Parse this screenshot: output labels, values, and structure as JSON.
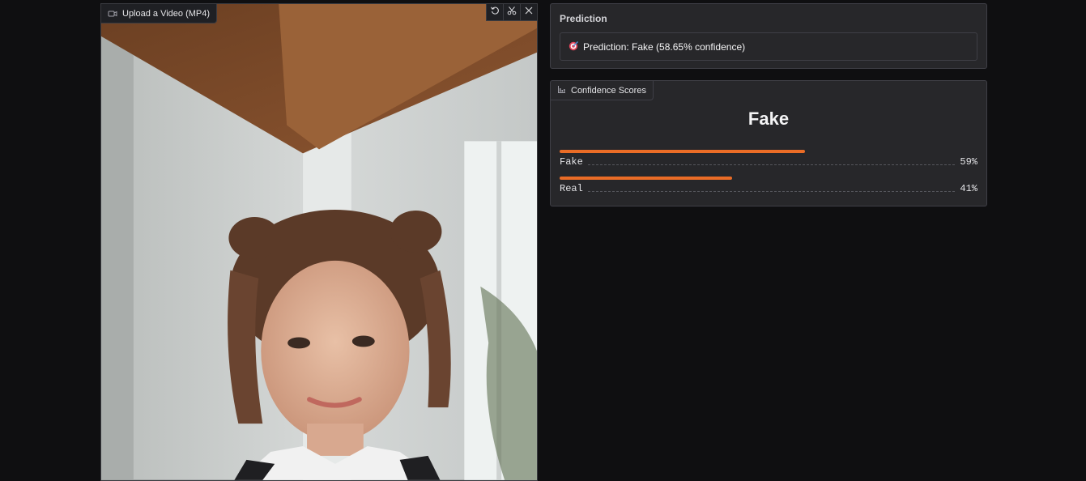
{
  "video": {
    "label": "Upload a Video (MP4)",
    "icon": "video-icon",
    "tools": [
      "undo-icon",
      "scissors-icon",
      "close-icon"
    ]
  },
  "prediction": {
    "title": "Prediction",
    "icon": "dart-icon",
    "text": "Prediction: Fake (58.65% confidence)"
  },
  "scores": {
    "tab_label": "Confidence Scores",
    "tab_icon": "bar-chart-icon",
    "top_label": "Fake",
    "accent_color": "#ea6c26",
    "items": [
      {
        "label": "Fake",
        "percent": "59%",
        "value": 0.5865
      },
      {
        "label": "Real",
        "percent": "41%",
        "value": 0.4135
      }
    ]
  }
}
